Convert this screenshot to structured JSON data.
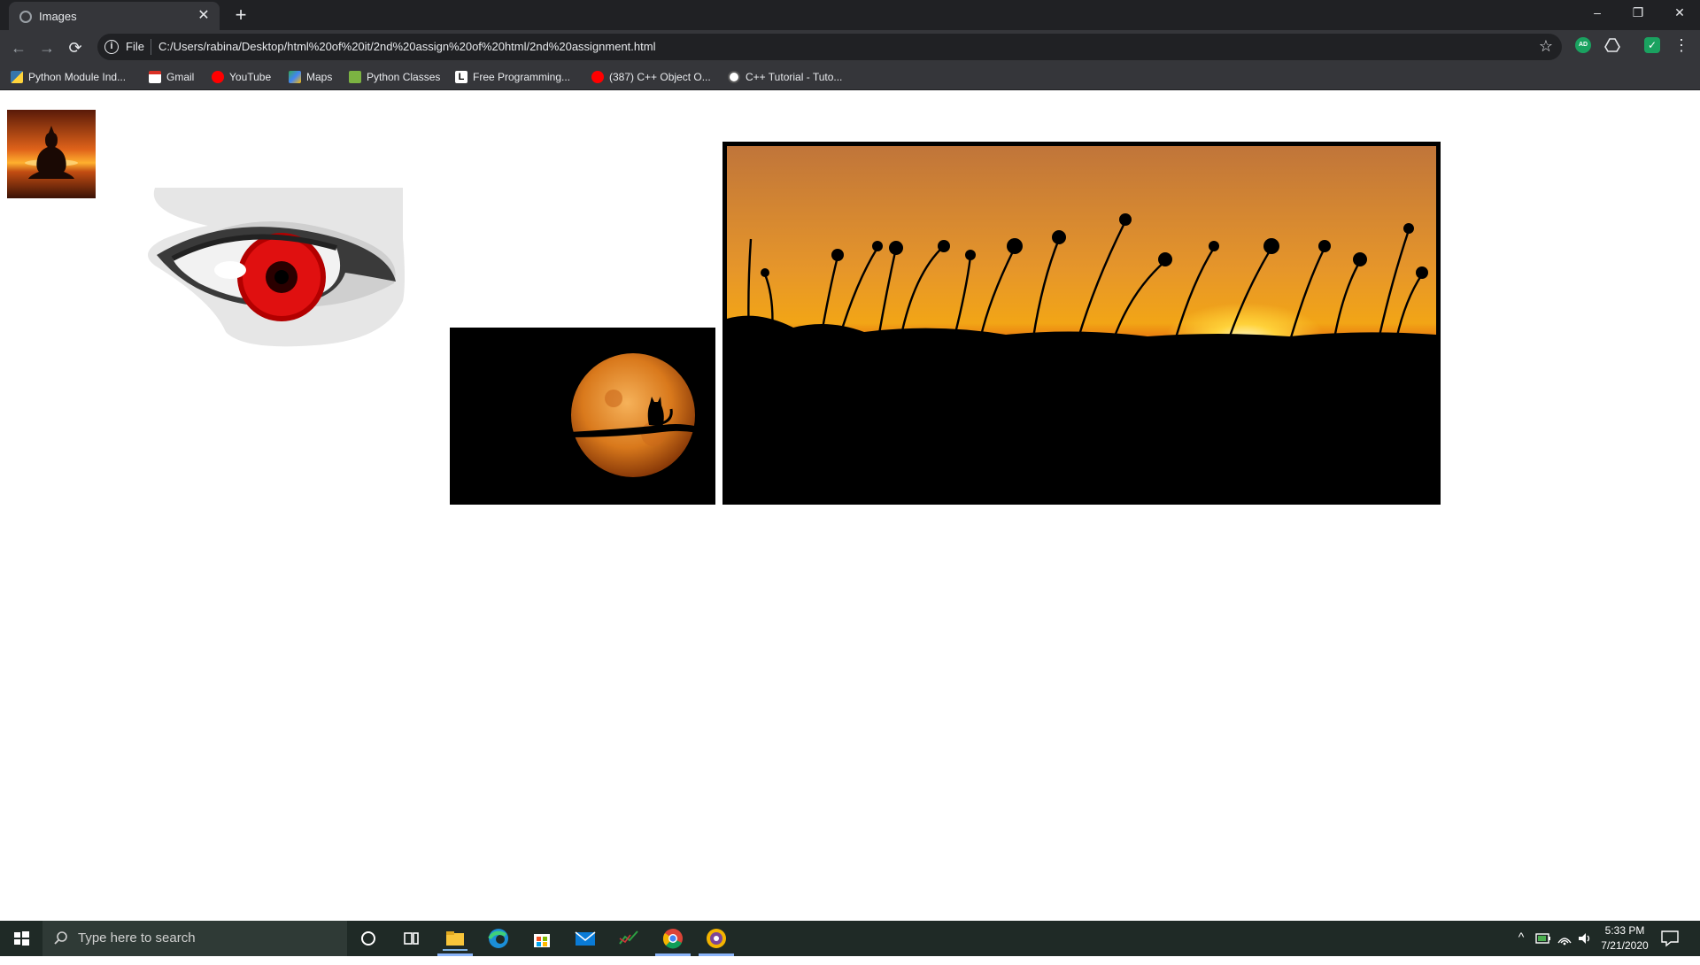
{
  "browser": {
    "tab_title": "Images",
    "tab_close": "✕",
    "new_tab": "+",
    "window_controls": {
      "minimize": "–",
      "restore": "❐",
      "close": "✕"
    },
    "nav": {
      "back": "←",
      "forward": "→",
      "reload": "⟳"
    },
    "omnibox": {
      "info": "i",
      "scheme_label": "File",
      "url": "C:/Users/rabina/Desktop/html%20of%20it/2nd%20assign%20of%20html/2nd%20assignment.html",
      "star": "☆"
    },
    "extensions": [
      {
        "name": "adblock-extension",
        "label": "AD"
      },
      {
        "name": "drive-extension",
        "label": ""
      },
      {
        "name": "shield-extension",
        "label": "✓"
      }
    ],
    "menu": "⋮"
  },
  "bookmarks": [
    {
      "label": "Python Module Ind...",
      "icon": "python-icon"
    },
    {
      "label": "Gmail",
      "icon": "gmail-icon"
    },
    {
      "label": "YouTube",
      "icon": "youtube-icon"
    },
    {
      "label": "Maps",
      "icon": "maps-icon"
    },
    {
      "label": "Python Classes",
      "icon": "python-classes-icon"
    },
    {
      "label": "Free Programming...",
      "icon": "l-icon"
    },
    {
      "label": "(387) C++ Object O...",
      "icon": "youtube-icon"
    },
    {
      "label": "C++ Tutorial - Tuto...",
      "icon": "cpp-icon"
    }
  ],
  "page": {
    "images": [
      {
        "name": "meditation-sunset-image",
        "subject": "silhouette meditating at sunset"
      },
      {
        "name": "red-eye-image",
        "subject": "stylized red eye"
      },
      {
        "name": "moon-cat-image",
        "subject": "cat on branch before full moon"
      },
      {
        "name": "sunset-flowers-image",
        "subject": "flower silhouettes at sunset"
      }
    ]
  },
  "taskbar": {
    "search_placeholder": "Type here to search",
    "time": "5:33 PM",
    "date": "7/21/2020",
    "tray_up": "^"
  },
  "colors": {
    "chrome_dark": "#202124",
    "chrome_mid": "#35363a",
    "taskbar": "#1f2a26"
  }
}
